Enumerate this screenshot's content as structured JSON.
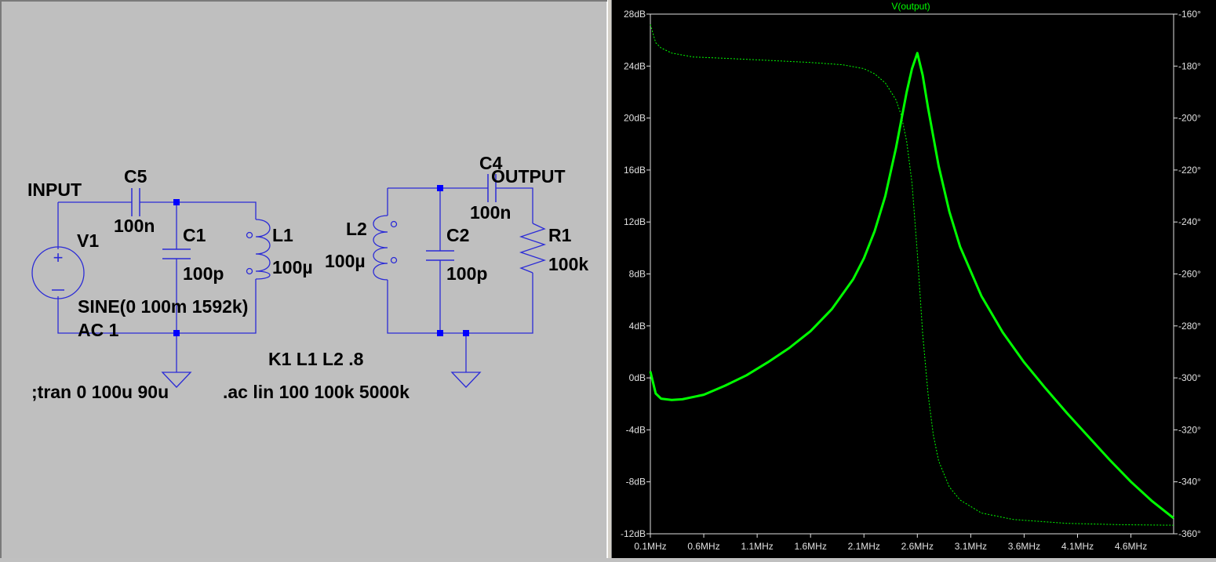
{
  "schematic": {
    "net_input": "INPUT",
    "net_output": "OUTPUT",
    "components": {
      "v1": {
        "name": "V1",
        "value_line1": "SINE(0 100m 1592k)",
        "value_line2": "AC 1"
      },
      "c5": {
        "name": "C5",
        "value": "100n"
      },
      "c1": {
        "name": "C1",
        "value": "100p"
      },
      "l1": {
        "name": "L1",
        "value": "100µ"
      },
      "l2": {
        "name": "L2",
        "value": "100µ"
      },
      "c2": {
        "name": "C2",
        "value": "100p"
      },
      "c4": {
        "name": "C4",
        "value": "100n"
      },
      "r1": {
        "name": "R1",
        "value": "100k"
      }
    },
    "directives": {
      "coupling": "K1 L1 L2 .8",
      "tran": ";tran 0 100u 90u",
      "ac": ".ac lin 100 100k 5000k"
    }
  },
  "plot": {
    "trace_name": "V(output)",
    "colors": {
      "background": "#000000",
      "trace": "#00ff00",
      "grid_text": "#e0e0e0"
    },
    "x_ticks": [
      "0.1MHz",
      "0.6MHz",
      "1.1MHz",
      "1.6MHz",
      "2.1MHz",
      "2.6MHz",
      "3.1MHz",
      "3.6MHz",
      "4.1MHz",
      "4.6MHz"
    ],
    "y_left_ticks": [
      "28dB",
      "24dB",
      "20dB",
      "16dB",
      "12dB",
      "8dB",
      "4dB",
      "0dB",
      "-4dB",
      "-8dB",
      "-12dB"
    ],
    "y_right_ticks": [
      "-160°",
      "-180°",
      "-200°",
      "-220°",
      "-240°",
      "-260°",
      "-280°",
      "-300°",
      "-320°",
      "-340°",
      "-360°"
    ]
  },
  "chart_data": {
    "type": "line",
    "title": "V(output)",
    "xlabel": "",
    "ylabel": "",
    "x_unit": "MHz",
    "xlim": [
      0.1,
      5.0
    ],
    "ylim": [
      -12,
      28
    ],
    "y2lim": [
      -360,
      -160
    ],
    "grid": false,
    "series": [
      {
        "name": "V(output)",
        "axis": "left",
        "style": "solid",
        "x": [
          0.1,
          0.15,
          0.2,
          0.3,
          0.4,
          0.6,
          0.8,
          1.0,
          1.2,
          1.4,
          1.6,
          1.8,
          2.0,
          2.1,
          2.2,
          2.3,
          2.4,
          2.5,
          2.55,
          2.6,
          2.65,
          2.7,
          2.8,
          2.9,
          3.0,
          3.2,
          3.4,
          3.6,
          3.8,
          4.0,
          4.2,
          4.4,
          4.6,
          4.8,
          5.0
        ],
        "y": [
          0.5,
          -1.2,
          -1.6,
          -1.7,
          -1.65,
          -1.3,
          -0.6,
          0.2,
          1.2,
          2.3,
          3.6,
          5.3,
          7.6,
          9.2,
          11.3,
          14.0,
          17.7,
          22.0,
          23.8,
          25.0,
          23.3,
          20.8,
          16.3,
          12.8,
          10.1,
          6.3,
          3.5,
          1.2,
          -0.8,
          -2.7,
          -4.5,
          -6.3,
          -8.0,
          -9.5,
          -10.8
        ]
      },
      {
        "name": "V(output) phase",
        "axis": "right",
        "style": "dashed",
        "x": [
          0.1,
          0.15,
          0.2,
          0.3,
          0.5,
          0.8,
          1.2,
          1.6,
          1.9,
          2.1,
          2.2,
          2.3,
          2.4,
          2.45,
          2.5,
          2.55,
          2.6,
          2.65,
          2.7,
          2.75,
          2.8,
          2.9,
          3.0,
          3.2,
          3.5,
          4.0,
          4.5,
          5.0
        ],
        "y": [
          -164,
          -171,
          -173,
          -175,
          -176.5,
          -177,
          -177.8,
          -178.6,
          -179.5,
          -181,
          -183,
          -186.5,
          -193,
          -199,
          -209,
          -225,
          -252,
          -283,
          -306,
          -322,
          -332,
          -342,
          -347,
          -352,
          -354.5,
          -356,
          -356.5,
          -356.7
        ]
      }
    ]
  }
}
